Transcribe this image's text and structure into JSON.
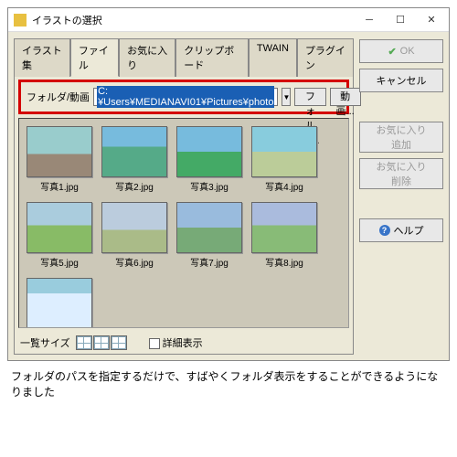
{
  "title": "イラストの選択",
  "tabs": [
    "イラスト集",
    "ファイル",
    "お気に入り",
    "クリップボード",
    "TWAIN",
    "プラグイン"
  ],
  "active_tab": 1,
  "path": {
    "label": "フォルダ/動画",
    "value": "C:¥Users¥MEDIANAVI01¥Pictures¥photo",
    "folder_btn": "フォルダ...",
    "movie_btn": "動画..."
  },
  "files": [
    "写真1.jpg",
    "写真2.jpg",
    "写真3.jpg",
    "写真4.jpg",
    "写真5.jpg",
    "写真6.jpg",
    "写真7.jpg",
    "写真8.jpg"
  ],
  "bottom": {
    "size_label": "一覧サイズ",
    "detail_label": "詳細表示"
  },
  "buttons": {
    "ok": "OK",
    "cancel": "キャンセル",
    "fav_add": "お気に入り\n追加",
    "fav_del": "お気に入り\n削除",
    "help": "ヘルプ"
  },
  "caption": "フォルダのパスを指定するだけで、すばやくフォルダ表示をすることができるようになりました"
}
